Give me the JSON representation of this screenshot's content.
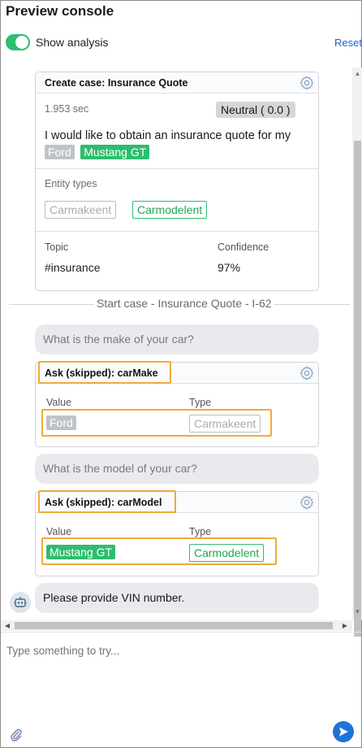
{
  "header": {
    "title": "Preview console",
    "toggle_label": "Show analysis",
    "reset_label": "Reset"
  },
  "analysis_card": {
    "title": "Create case:  Insurance Quote",
    "duration": "1.953 sec",
    "sentiment": "Neutral ( 0.0 )",
    "utterance": "I would like to obtain an insurance quote for my",
    "entity_values": [
      "Ford",
      "Mustang GT"
    ],
    "entity_types_label": "Entity types",
    "entity_types": [
      "Carmakeent",
      "Carmodelent"
    ],
    "topic_label": "Topic",
    "confidence_label": "Confidence",
    "topic": "#insurance",
    "confidence": "97%"
  },
  "separator": "Start case - Insurance Quote - I-62",
  "messages": {
    "q_make": "What is the make of your car?",
    "q_model": "What is the model of your car?",
    "bot_vin": "Please provide VIN number."
  },
  "make_card": {
    "title": "Ask (skipped):  carMake",
    "value_label": "Value",
    "type_label": "Type",
    "value": "Ford",
    "type": "Carmakeent"
  },
  "model_card": {
    "title": "Ask (skipped):  carModel",
    "value_label": "Value",
    "type_label": "Type",
    "value": "Mustang GT",
    "type": "Carmodelent"
  },
  "input": {
    "placeholder": "Type something to try..."
  },
  "colors": {
    "accent_green": "#2dbd6e",
    "highlight_orange": "#f2a93b",
    "send_blue": "#1e73d8"
  },
  "toggle_on": true
}
